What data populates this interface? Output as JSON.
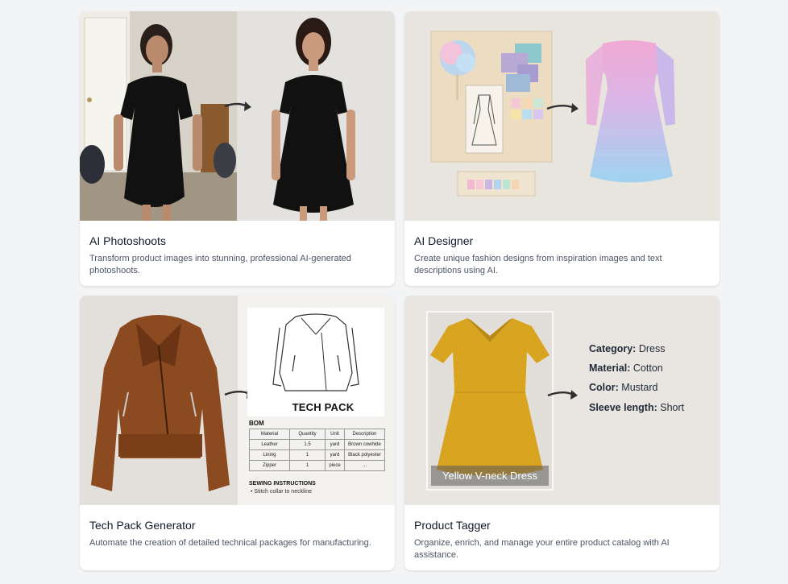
{
  "cards": [
    {
      "title": "AI Photoshoots",
      "description": "Transform product images into stunning, professional AI-generated photoshoots.",
      "image": "before-after-model-photoshoot"
    },
    {
      "title": "AI Designer",
      "description": "Create unique fashion designs from inspiration images and text descriptions using AI.",
      "image": "moodboard-to-dress-design"
    },
    {
      "title": "Tech Pack Generator",
      "description": "Automate the creation of detailed technical packages for manufacturing.",
      "image": "jacket-to-tech-pack",
      "techpack": {
        "heading": "TECH PACK",
        "bom_label": "BOM",
        "bom_headers": [
          "Material",
          "Quantity",
          "Unit",
          "Description"
        ],
        "bom_rows": [
          [
            "Leather",
            "1.5",
            "yard",
            "Brown cowhide"
          ],
          [
            "Lining",
            "1",
            "yard",
            "Black polyester"
          ],
          [
            "Zipper",
            "1",
            "piece",
            "..."
          ]
        ],
        "sewing_label": "SEWING INSTRUCTIONS",
        "sewing_item": "• Stitch collar to neckline"
      }
    },
    {
      "title": "Product Tagger",
      "description": "Organize, enrich, and manage your entire product catalog with AI assistance.",
      "image": "dress-to-product-tags",
      "caption": "Yellow V-neck Dress",
      "attributes": [
        {
          "key": "Category:",
          "value": "Dress"
        },
        {
          "key": "Material:",
          "value": "Cotton"
        },
        {
          "key": "Color:",
          "value": "Mustard"
        },
        {
          "key": "Sleeve length:",
          "value": "Short"
        }
      ]
    }
  ],
  "colors": {
    "page_background": "#f3f4f6",
    "card_background": "#ffffff",
    "title_text": "#111827",
    "description_text": "#4b5563",
    "arrow": "#2f2f2f",
    "mustard": "#d9a521",
    "leather": "#8b4a1f"
  }
}
